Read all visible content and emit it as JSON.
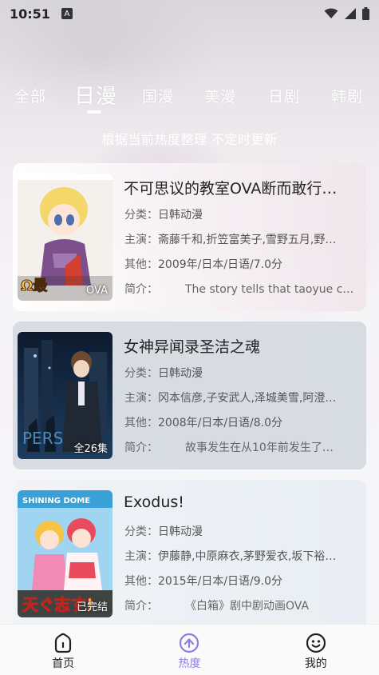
{
  "status_bar": {
    "time": "10:51",
    "indicator": "A"
  },
  "tabs": [
    {
      "label": "全部",
      "active": false
    },
    {
      "label": "日漫",
      "active": true
    },
    {
      "label": "国漫",
      "active": false
    },
    {
      "label": "美漫",
      "active": false
    },
    {
      "label": "日剧",
      "active": false
    },
    {
      "label": "韩剧",
      "active": false
    }
  ],
  "subtitle": "根据当前热度整理 不定时更新",
  "labels": {
    "category": "分类：",
    "cast": "主演：",
    "other": "其他：",
    "intro": "简介："
  },
  "cards": [
    {
      "title": "不可思议的教室OVA断而敢行…",
      "category": "日韩动漫",
      "cast": "斋藤千和,折笠富美子,雪野五月,野…",
      "other": "2009年/日本/日语/7.0分",
      "intro": "The story tells that taoyue co…",
      "badge": "OVA"
    },
    {
      "title": "女神异闻录圣洁之魂",
      "category": "日韩动漫",
      "cast": "冈本信彦,子安武人,泽城美雪,阿澄…",
      "other": "2008年/日本/日语/8.0分",
      "intro": "故事发生在从10年前发生了…",
      "badge": "全26集"
    },
    {
      "title": "Exodus!",
      "category": "日韩动漫",
      "cast": "伊藤静,中原麻衣,茅野爱衣,坂下裕…",
      "other": "2015年/日本/日语/9.0分",
      "intro": "《白箱》剧中剧动画OVA",
      "badge": "已完结"
    }
  ],
  "bottom_nav": [
    {
      "label": "首页",
      "icon": "home-icon",
      "active": false
    },
    {
      "label": "热度",
      "icon": "hot-icon",
      "active": true
    },
    {
      "label": "我的",
      "icon": "profile-icon",
      "active": false
    }
  ],
  "colors": {
    "accent": "#8a7fe0",
    "tab_text": "#ffffff"
  }
}
